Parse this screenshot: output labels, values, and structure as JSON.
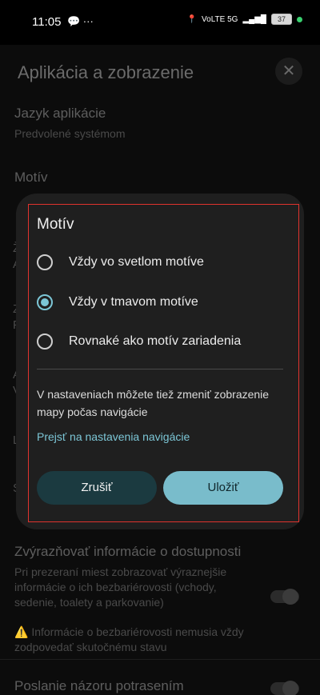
{
  "status_bar": {
    "time": "11:05",
    "left_icons": "💬 ···",
    "network": "VoLTE 5G",
    "battery": "37"
  },
  "settings": {
    "page_title": "Aplikácia a zobrazenie",
    "close_glyph": "✕",
    "language": {
      "title": "Jazyk aplikácie",
      "value": "Predvolené systémom"
    },
    "theme": {
      "title": "Motív",
      "value": "Vždy v tmavom motíve"
    },
    "peek_letters": [
      "Ž",
      "A",
      "Z",
      "P",
      "A",
      "V",
      "L",
      "S"
    ],
    "accessibility": {
      "title": "Zvýrazňovať informácie o dostupnosti",
      "description": "Pri prezeraní miest zobrazovať výraznejšie informácie o ich bezbariérovosti (vchody, sedenie, toalety a parkovanie)",
      "warning": "⚠️ Informácie o bezbariérovosti nemusia vždy zodpovedať skutočnému stavu"
    },
    "feedback": {
      "title": "Poslanie názoru potrasením"
    }
  },
  "dialog": {
    "title": "Motív",
    "options": [
      {
        "label": "Vždy vo svetlom motíve",
        "selected": false
      },
      {
        "label": "Vždy v tmavom motíve",
        "selected": true
      },
      {
        "label": "Rovnaké ako motív zariadenia",
        "selected": false
      }
    ],
    "info": "V nastaveniach môžete tiež zmeniť zobrazenie mapy počas navigácie",
    "link": "Prejsť na nastavenia navigácie",
    "cancel_label": "Zrušiť",
    "save_label": "Uložiť"
  },
  "colors": {
    "accent": "#7cc6d6",
    "dialog_bg": "#1f1f1f",
    "highlight_border": "#e0332e"
  }
}
